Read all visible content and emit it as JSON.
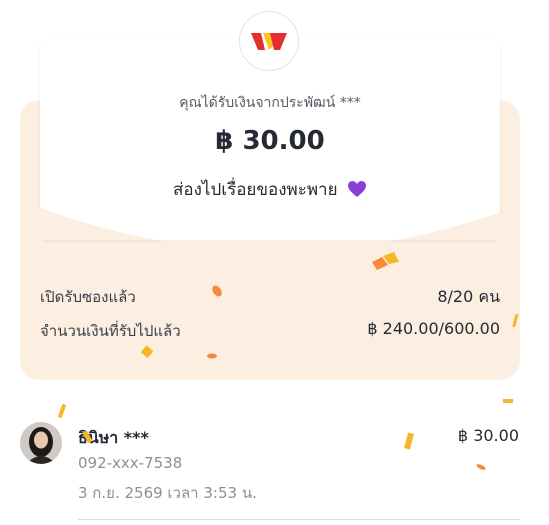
{
  "envelope": {
    "sender_line": "คุณได้รับเงินจากประพัฒน์ ***",
    "amount": "฿ 30.00",
    "message": "ส่องไปเรื่อยของพะพาย",
    "heart_icon": "purple-heart-icon",
    "opened_label": "เปิดรับซองแล้ว",
    "opened_value": "8/20 คน",
    "received_label": "จำนวนเงินที่รับไปแล้ว",
    "received_value": "฿ 240.00/600.00"
  },
  "recipients": [
    {
      "name": "ธินิษา ***",
      "phone": "092-xxx-7538",
      "date": "3 ก.ย. 2569 เวลา 3:53 น.",
      "amount": "฿ 30.00"
    }
  ],
  "colors": {
    "envelope": "#fdeee2",
    "card": "#ffffff",
    "logo_red": "#e62e2e",
    "logo_yellow": "#ffc21a",
    "confetti_orange": "#f58a3a",
    "confetti_yellow": "#f5b62a",
    "heart": "#8b3fd9"
  }
}
